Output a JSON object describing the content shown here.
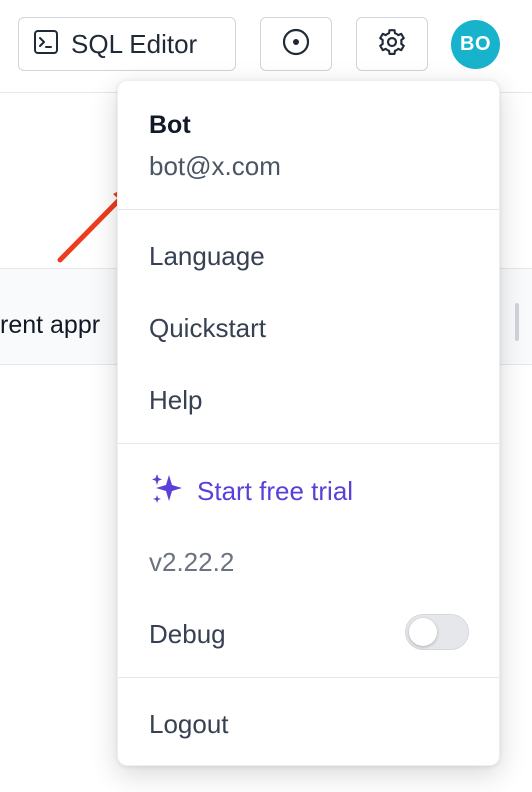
{
  "header": {
    "sql_editor_label": "SQL Editor",
    "avatar_initials": "BO"
  },
  "background": {
    "row_text": "rent appr"
  },
  "user_menu": {
    "name": "Bot",
    "email": "bot@x.com",
    "items": [
      {
        "label": "Language"
      },
      {
        "label": "Quickstart"
      },
      {
        "label": "Help"
      }
    ],
    "trial_label": "Start free trial",
    "version": "v2.22.2",
    "debug_label": "Debug",
    "debug_enabled": false,
    "logout_label": "Logout"
  },
  "colors": {
    "accent": "#5b3fd9",
    "avatar_bg": "#17b3cc",
    "annotation_arrow": "#ee3b1e"
  },
  "icons": {
    "sql_editor": "terminal-icon",
    "circle": "circle-dot-icon",
    "settings": "gear-icon",
    "trial": "sparkles-icon"
  }
}
